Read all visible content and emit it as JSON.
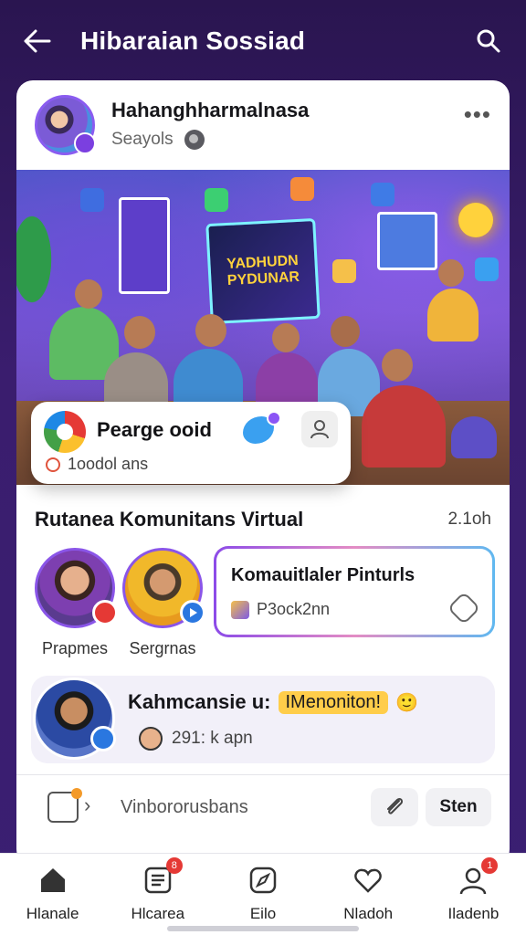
{
  "header": {
    "title": "Hibaraian Sossiad",
    "back_icon": "arrow-left-icon",
    "search_icon": "search-icon"
  },
  "post": {
    "author_name": "Hahanghharmalnasa",
    "meta": "Seayols",
    "privacy_icon": "globe-icon",
    "more_icon": "more-horizontal-icon",
    "hero_banner_text": "YADHUDN PYDUNAR"
  },
  "floating_card": {
    "title": "Pearge ooid",
    "subtitle": "1oodol ans",
    "left_icon": "google-icon",
    "bird_icon": "bird-icon",
    "user_icon": "user-icon"
  },
  "community": {
    "title": "Rutanea Komunitans Virtual",
    "time": "2.1oh",
    "stories": [
      {
        "label": "Prapmes",
        "badge_color": "#e53935"
      },
      {
        "label": "Sergrnas",
        "badge_color": "#2a77e0"
      }
    ],
    "chip": {
      "title": "Komauitlaler Pinturls",
      "subtitle": "P3ock2nn"
    }
  },
  "comment": {
    "author": "Kahmcansie u:",
    "tag": "IMenoniton!",
    "emoji": "🙂",
    "meta": "291: k apn"
  },
  "composer": {
    "placeholder": "Vinbororusbans",
    "send_label": "Sten"
  },
  "tabs": [
    {
      "label": "Hlanale",
      "icon": "home-icon",
      "badge": ""
    },
    {
      "label": "Hlcarea",
      "icon": "list-icon",
      "badge": "8"
    },
    {
      "label": "Eilo",
      "icon": "compass-icon",
      "badge": ""
    },
    {
      "label": "Nladoh",
      "icon": "heart-icon",
      "badge": ""
    },
    {
      "label": "Iladenb",
      "icon": "person-icon",
      "badge": "1"
    }
  ],
  "colors": {
    "accent": "#8a55e8",
    "header_bg": "#2a1550",
    "badge": "#e53935"
  }
}
